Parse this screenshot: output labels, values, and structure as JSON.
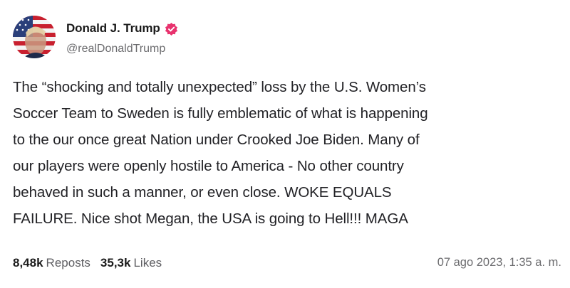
{
  "author": {
    "display_name": "Donald J. Trump",
    "handle": "@realDonaldTrump",
    "verified": true,
    "verified_color": "#e8326e"
  },
  "post": {
    "lines": [
      "The “shocking and totally unexpected” loss by the U.S. Women’s",
      "Soccer Team to Sweden is fully emblematic of what is happening",
      "to the our once great Nation under Crooked Joe Biden. Many of",
      "our players were openly hostile to America - No other country",
      "behaved in such a manner, or even close. WOKE EQUALS",
      "FAILURE. Nice shot Megan, the USA is going to Hell!!! MAGA"
    ]
  },
  "stats": {
    "reposts_value": "8,48k",
    "reposts_label": "Reposts",
    "likes_value": "35,3k",
    "likes_label": "Likes"
  },
  "timestamp": "07 ago 2023, 1:35 a. m."
}
